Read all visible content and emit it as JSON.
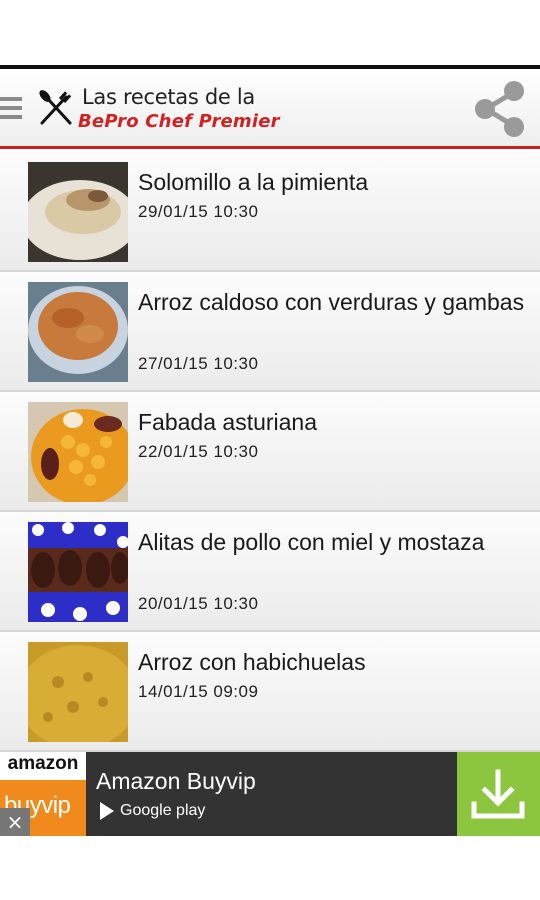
{
  "header": {
    "brand_line1": "Las recetas de la",
    "brand_line2": "BePro Chef Premier",
    "menu_icon": "hamburger-menu-icon",
    "share_icon": "share-icon",
    "accent_color": "#cc1f1f"
  },
  "recipes": [
    {
      "title": "Solomillo a la pimienta",
      "date": "29/01/15 10:30",
      "image": "plate-with-steak"
    },
    {
      "title": "Arroz caldoso con verduras y gambas",
      "date": "27/01/15 10:30",
      "image": "rice-soup"
    },
    {
      "title": "Fabada asturiana",
      "date": "22/01/15 10:30",
      "image": "bean-stew"
    },
    {
      "title": "Alitas de pollo con miel y mostaza",
      "date": "20/01/15 10:30",
      "image": "chicken-wings"
    },
    {
      "title": "Arroz con habichuelas",
      "date": "14/01/15 09:09",
      "image": "rice-with-beans"
    }
  ],
  "ad": {
    "logo_top": "amazon",
    "logo_bottom": "buyvip",
    "title": "Amazon Buyvip",
    "subtitle": "Google play",
    "close_label": "×",
    "download_icon": "download-icon",
    "cta_color": "#8cc63f"
  }
}
